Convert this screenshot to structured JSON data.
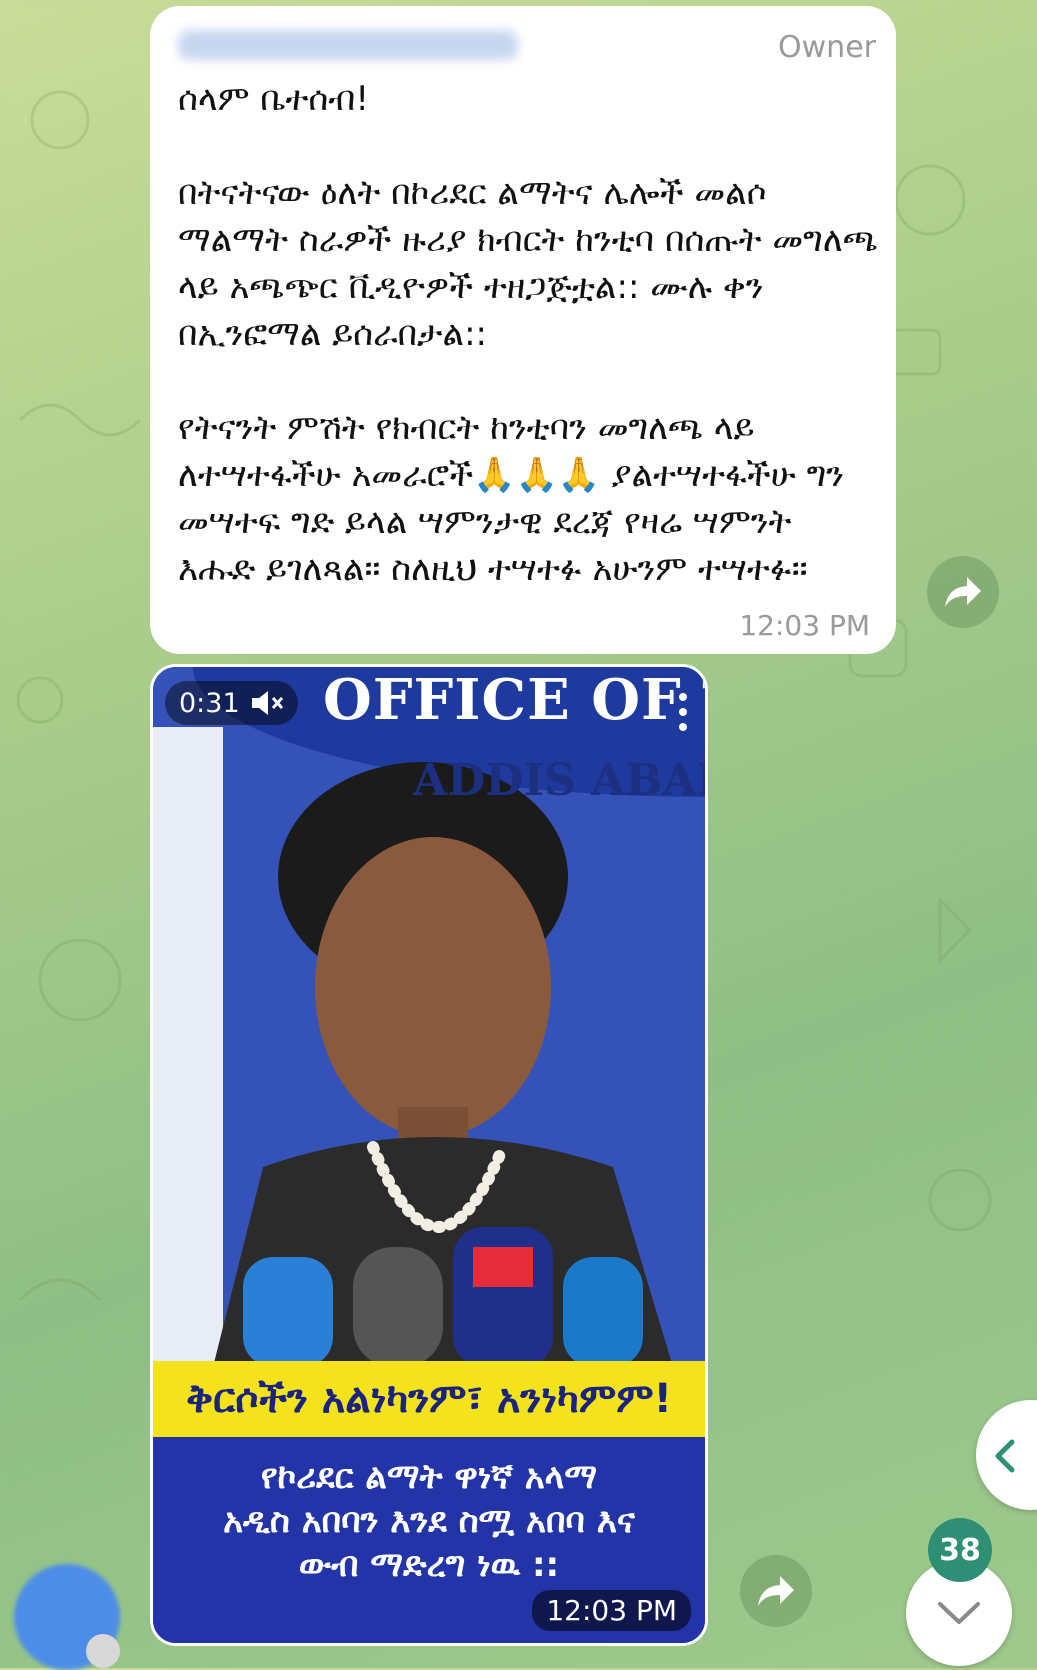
{
  "message": {
    "role": "Owner",
    "text": "ሰላም ቤተሰብ!\n\nበትናትናው ዕለት በኮሪደር ልማትና ሌሎች መልሶ ማልማት ስራዎች ዙሪያ ክብርት ከንቲባ በሰጡት መግለጫ ላይ አጫጭር ቪዲዮዎች ተዘጋጅቷል:: ሙሉ ቀን በኢንፎማል ይሰራበታል::\n\nየትናንት ምሽት የክብርት ከንቲባን መግለጫ ላይ ለተሣተፋችሁ አመራሮች🙏🙏🙏 ያልተሣተፋችሁ ግን መሣተፍ ግድ ይላል ሣምንታዊ ደረጃ የዛሬ ሣምንት እሑድ ይገለጻል። ስለዚህ ተሣተፉ አሁንም ተሣተፉ።",
    "time": "12:03 PM"
  },
  "video": {
    "duration": "0:31",
    "sign_line1": "OFFICE OF T",
    "sign_line2": "ADDIS ABAB",
    "banner_headline": "ቅርሶችን አልነካንም፣ አንነካምም!",
    "banner_caption": "የኮሪደር ልማት ዋነኛ አላማ\nአዲስ አበባን እንደ ስሟ አበባ እና\nውብ ማድረግ ነዉ ::",
    "time": "12:03 PM"
  },
  "unread_count": "38",
  "colors": {
    "accent": "#2f8f74",
    "banner_yellow": "#f4e21c",
    "banner_blue": "#2234a8"
  }
}
